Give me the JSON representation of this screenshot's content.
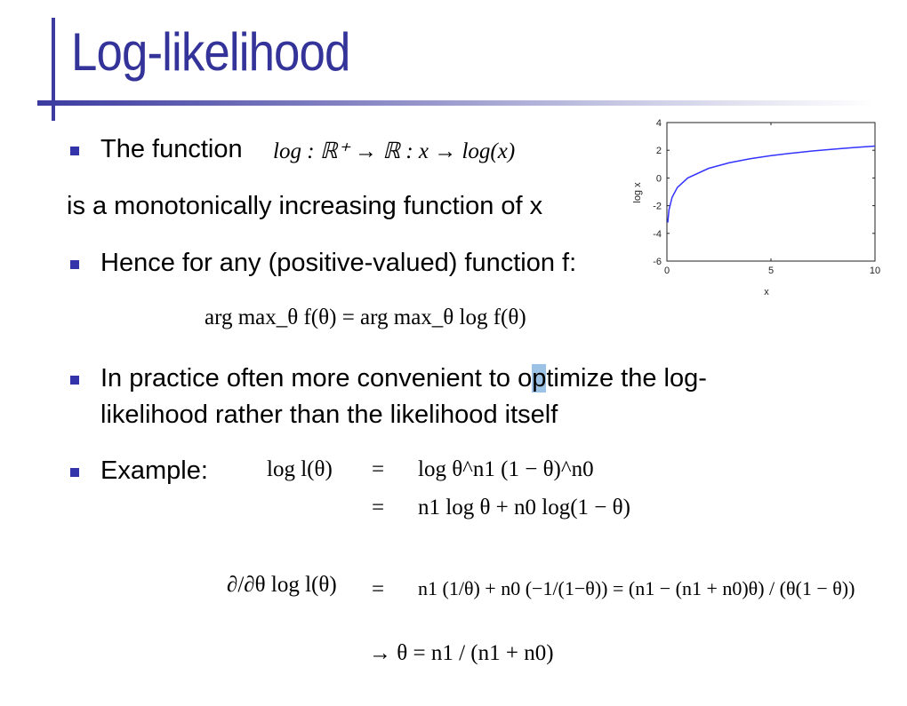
{
  "slide": {
    "title": "Log-likelihood",
    "bullet1_text": "The function",
    "bullet1_math": "log : ℝ⁺ → ℝ : x → log(x)",
    "line2": "is a monotonically increasing function of x",
    "bullet2": "Hence for any (positive-valued) function f:",
    "argmax_eq": "arg max_θ f(θ) = arg max_θ log f(θ)",
    "bullet3_line1_a": "In practice often more convenient to o",
    "bullet3_line1_hl": "p",
    "bullet3_line1_b": "timize the log-",
    "bullet3_line2": "likelihood rather than the likelihood itself",
    "bullet4": "Example:",
    "eq1_lhs": "log l(θ)",
    "eq1_rhs": "log θ^n1 (1 − θ)^n0",
    "eq2_rhs": "n1 log θ + n0 log(1 − θ)",
    "eq3_lhs": "∂/∂θ log l(θ)",
    "eq3_rhs": "n1 (1/θ) + n0 (−1/(1−θ)) = (n1 − (n1 + n0)θ) / (θ(1 − θ))",
    "eq4": "→ θ = n1 / (n1 + n0)"
  },
  "colors": {
    "title": "#333399",
    "bullet": "#3333aa",
    "curve": "#3333ff"
  },
  "chart_data": {
    "type": "line",
    "title": "",
    "xlabel": "x",
    "ylabel": "log x",
    "xlim": [
      0,
      10
    ],
    "ylim": [
      -6,
      4
    ],
    "xticks": [
      "0",
      "5",
      "10"
    ],
    "yticks": [
      "4",
      "2",
      "0",
      "-2",
      "-4",
      "-6"
    ],
    "grid": false,
    "series": [
      {
        "x": [
          0.04,
          0.1,
          0.25,
          0.5,
          1,
          2,
          3,
          4,
          5,
          6,
          7,
          8,
          9,
          10
        ],
        "y": [
          -3.22,
          -2.3,
          -1.39,
          -0.69,
          0,
          0.69,
          1.1,
          1.39,
          1.61,
          1.79,
          1.95,
          2.08,
          2.2,
          2.3
        ]
      }
    ]
  }
}
